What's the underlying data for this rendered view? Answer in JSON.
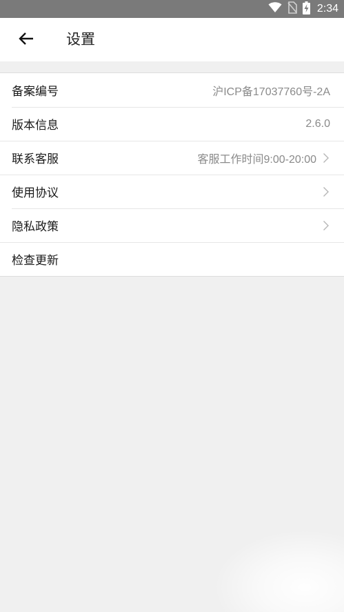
{
  "status_bar": {
    "time": "2:34",
    "icons": [
      "wifi-icon",
      "no-sim-icon",
      "battery-charging-icon"
    ]
  },
  "header": {
    "back_icon": "arrow-left-icon",
    "title": "设置"
  },
  "settings": {
    "items": [
      {
        "label": "备案编号",
        "value": "沪ICP备17037760号-2A"
      },
      {
        "label": "版本信息",
        "value": "2.6.0"
      },
      {
        "label": "联系客服",
        "value": "客服工作时间9:00-20:00"
      },
      {
        "label": "使用协议"
      },
      {
        "label": "隐私政策"
      },
      {
        "label": "检查更新"
      }
    ]
  },
  "colors": {
    "status_bar": "#7a7a7a",
    "background": "#f0f0f0",
    "surface": "#ffffff",
    "primary_text": "#1a1a1a",
    "secondary_text": "#8a8a8a",
    "divider": "#e6e6e6"
  }
}
